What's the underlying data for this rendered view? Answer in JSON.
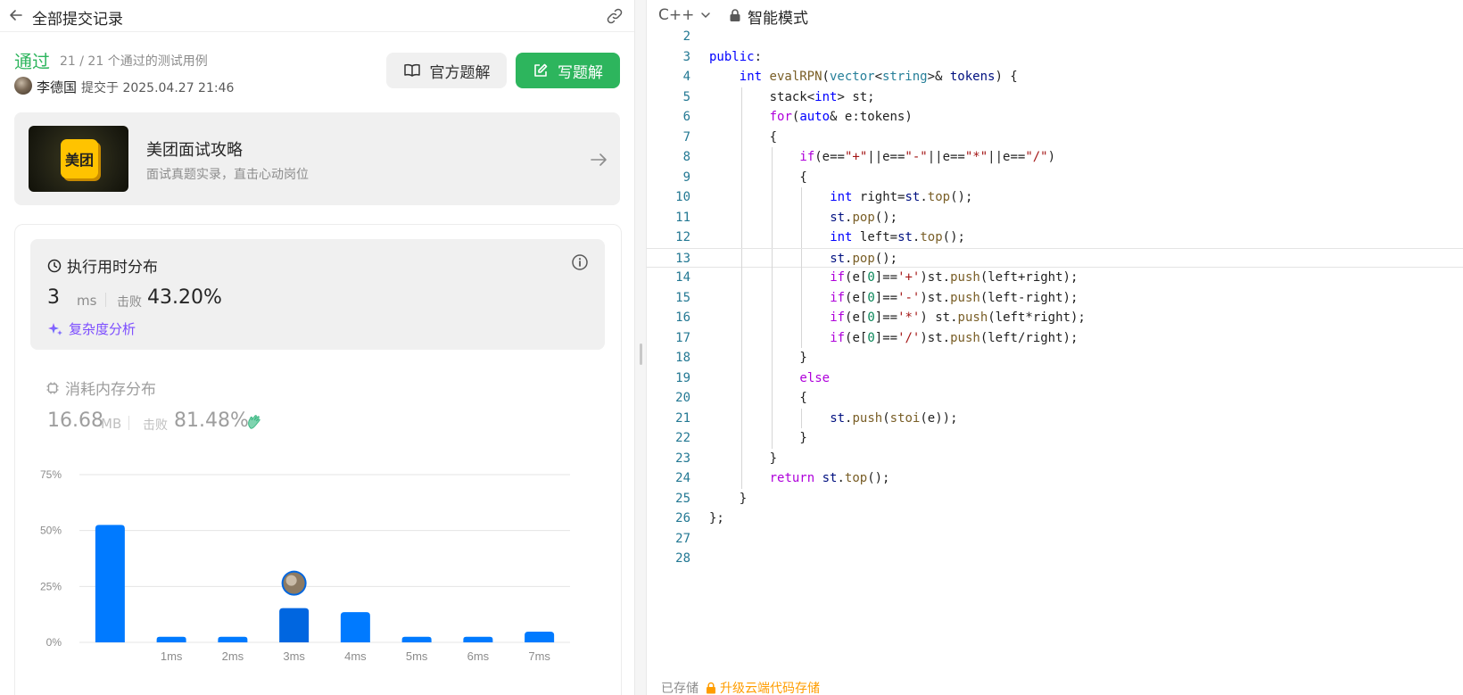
{
  "header": {
    "back_label": "全部提交记录"
  },
  "submission": {
    "status": "通过",
    "testcases": "21 / 21 个通过的测试用例",
    "author": "李德国",
    "submitted_at": "提交于 2025.04.27 21:46"
  },
  "buttons": {
    "official_solution": "官方题解",
    "write_solution": "写题解"
  },
  "ad": {
    "logo_text": "美团",
    "title": "美团面试攻略",
    "subtitle": "面试真题实录，直击心动岗位"
  },
  "runtime": {
    "title": "执行用时分布",
    "value": "3",
    "unit": "ms",
    "beat_label": "击败",
    "beat": "43.20%",
    "complexity_link": "复杂度分析"
  },
  "memory": {
    "title": "消耗内存分布",
    "value": "16.68",
    "unit": "MB",
    "beat_label": "击败",
    "beat": "81.48%"
  },
  "chart_data": {
    "type": "bar",
    "categories": [
      "",
      "1ms",
      "2ms",
      "3ms",
      "4ms",
      "5ms",
      "6ms",
      "7ms"
    ],
    "tick_labels": [
      "",
      "1ms",
      "2ms",
      "3ms",
      "4ms",
      "5ms",
      "6ms",
      "7ms"
    ],
    "values": [
      52.5,
      2.5,
      2.5,
      15.3,
      13.5,
      2.5,
      2.5,
      4.8
    ],
    "highlight_index": 3,
    "y_ticks": [
      0,
      25,
      50,
      75
    ],
    "y_tick_labels": [
      "0%",
      "25%",
      "50%",
      "75%"
    ],
    "ylim": [
      0,
      75
    ],
    "grid": true,
    "colors": {
      "bar": "#007aff",
      "bar_highlight": "#0066e0",
      "grid": "#e5e5e5"
    }
  },
  "editor": {
    "language": "C++",
    "mode": "智能模式",
    "current_line": 13
  },
  "code_lines": [
    {
      "n": "2",
      "indent": 0,
      "t": []
    },
    {
      "n": "3",
      "indent": 0,
      "t": [
        [
          "kw",
          "public"
        ],
        [
          "",
          ":"
        ]
      ]
    },
    {
      "n": "4",
      "indent": 1,
      "t": [
        [
          "kw",
          "int"
        ],
        [
          "",
          " "
        ],
        [
          "fn",
          "evalRPN"
        ],
        [
          "",
          "("
        ],
        [
          "ty",
          "vector"
        ],
        [
          "",
          "<"
        ],
        [
          "ty",
          "string"
        ],
        [
          "",
          ">&"
        ],
        [
          "",
          " "
        ],
        [
          "va",
          "tokens"
        ],
        [
          "",
          ") {"
        ]
      ]
    },
    {
      "n": "5",
      "indent": 2,
      "t": [
        [
          "",
          "stack<"
        ],
        [
          "kw",
          "int"
        ],
        [
          "",
          "> st;"
        ]
      ]
    },
    {
      "n": "6",
      "indent": 2,
      "t": [
        [
          "ctl",
          "for"
        ],
        [
          "",
          "("
        ],
        [
          "kw",
          "auto"
        ],
        [
          "",
          "& e:tokens)"
        ]
      ]
    },
    {
      "n": "7",
      "indent": 2,
      "t": [
        [
          "",
          "{"
        ]
      ]
    },
    {
      "n": "8",
      "indent": 3,
      "t": [
        [
          "ctl",
          "if"
        ],
        [
          "",
          "(e=="
        ],
        [
          "str",
          "\"+\""
        ],
        [
          "",
          "||e=="
        ],
        [
          "str",
          "\"-\""
        ],
        [
          "",
          "||e=="
        ],
        [
          "str",
          "\"*\""
        ],
        [
          "",
          "||e=="
        ],
        [
          "str",
          "\"/\""
        ],
        [
          "",
          ")"
        ]
      ]
    },
    {
      "n": "9",
      "indent": 3,
      "t": [
        [
          "",
          "{"
        ]
      ]
    },
    {
      "n": "10",
      "indent": 4,
      "t": [
        [
          "kw",
          "int"
        ],
        [
          "",
          " right="
        ],
        [
          "va",
          "st"
        ],
        [
          "",
          "."
        ],
        [
          "fn",
          "top"
        ],
        [
          "",
          "();"
        ]
      ]
    },
    {
      "n": "11",
      "indent": 4,
      "t": [
        [
          "va",
          "st"
        ],
        [
          "",
          "."
        ],
        [
          "fn",
          "pop"
        ],
        [
          "",
          "();"
        ]
      ]
    },
    {
      "n": "12",
      "indent": 4,
      "t": [
        [
          "kw",
          "int"
        ],
        [
          "",
          " left="
        ],
        [
          "va",
          "st"
        ],
        [
          "",
          "."
        ],
        [
          "fn",
          "top"
        ],
        [
          "",
          "();"
        ]
      ]
    },
    {
      "n": "13",
      "indent": 4,
      "t": [
        [
          "va",
          "st"
        ],
        [
          "",
          "."
        ],
        [
          "fn",
          "pop"
        ],
        [
          "",
          "();"
        ]
      ]
    },
    {
      "n": "14",
      "indent": 4,
      "t": [
        [
          "ctl",
          "if"
        ],
        [
          "",
          "(e["
        ],
        [
          "num",
          "0"
        ],
        [
          "",
          "]=="
        ],
        [
          "str",
          "'+'"
        ],
        [
          "",
          ")st."
        ],
        [
          "fn",
          "push"
        ],
        [
          "",
          "(left+right);"
        ]
      ]
    },
    {
      "n": "15",
      "indent": 4,
      "t": [
        [
          "ctl",
          "if"
        ],
        [
          "",
          "(e["
        ],
        [
          "num",
          "0"
        ],
        [
          "",
          "]=="
        ],
        [
          "str",
          "'-'"
        ],
        [
          "",
          ")st."
        ],
        [
          "fn",
          "push"
        ],
        [
          "",
          "(left-right);"
        ]
      ]
    },
    {
      "n": "16",
      "indent": 4,
      "t": [
        [
          "ctl",
          "if"
        ],
        [
          "",
          "(e["
        ],
        [
          "num",
          "0"
        ],
        [
          "",
          "]=="
        ],
        [
          "str",
          "'*'"
        ],
        [
          "",
          ") st."
        ],
        [
          "fn",
          "push"
        ],
        [
          "",
          "(left*right);"
        ]
      ]
    },
    {
      "n": "17",
      "indent": 4,
      "t": [
        [
          "ctl",
          "if"
        ],
        [
          "",
          "(e["
        ],
        [
          "num",
          "0"
        ],
        [
          "",
          "]=="
        ],
        [
          "str",
          "'/'"
        ],
        [
          "",
          ")st."
        ],
        [
          "fn",
          "push"
        ],
        [
          "",
          "(left/right);"
        ]
      ]
    },
    {
      "n": "18",
      "indent": 3,
      "t": [
        [
          "",
          "}"
        ]
      ]
    },
    {
      "n": "19",
      "indent": 3,
      "t": [
        [
          "ctl",
          "else"
        ]
      ]
    },
    {
      "n": "20",
      "indent": 3,
      "t": [
        [
          "",
          "{"
        ]
      ]
    },
    {
      "n": "21",
      "indent": 4,
      "t": [
        [
          "va",
          "st"
        ],
        [
          "",
          "."
        ],
        [
          "fn",
          "push"
        ],
        [
          "",
          "("
        ],
        [
          "fn",
          "stoi"
        ],
        [
          "",
          "(e));"
        ]
      ]
    },
    {
      "n": "22",
      "indent": 3,
      "t": [
        [
          "",
          "}"
        ]
      ]
    },
    {
      "n": "23",
      "indent": 2,
      "t": [
        [
          "",
          "}"
        ]
      ]
    },
    {
      "n": "24",
      "indent": 2,
      "t": [
        [
          "ctl",
          "return"
        ],
        [
          "",
          " "
        ],
        [
          "va",
          "st"
        ],
        [
          "",
          "."
        ],
        [
          "fn",
          "top"
        ],
        [
          "",
          "();"
        ]
      ]
    },
    {
      "n": "25",
      "indent": 1,
      "t": [
        [
          "",
          "}"
        ]
      ]
    },
    {
      "n": "26",
      "indent": 0,
      "t": [
        [
          "",
          "};"
        ]
      ]
    },
    {
      "n": "27",
      "indent": 0,
      "t": []
    },
    {
      "n": "28",
      "indent": 0,
      "t": []
    }
  ],
  "footer": {
    "saved": "已存储",
    "upgrade": "升级云端代码存储"
  },
  "icons": [
    "arrow-left-icon",
    "link-icon",
    "avatar",
    "book-icon",
    "edit-icon",
    "arrow-right-icon",
    "clock-icon",
    "info-icon",
    "sparkle-icon",
    "chip-icon",
    "clap-icon",
    "chevron-down-icon",
    "lock-icon"
  ]
}
